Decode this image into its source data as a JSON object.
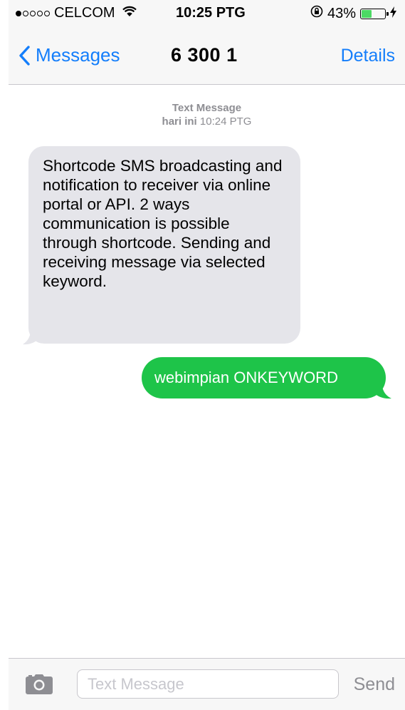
{
  "status_bar": {
    "signal_strength": 1,
    "signal_max": 5,
    "carrier": "CELCOM",
    "wifi_icon": "wifi-icon",
    "time": "10:25 PTG",
    "orientation_lock_icon": "orientation-lock-icon",
    "battery_percent": "43%",
    "battery_level": 0.43,
    "charging_icon": "lightning-bolt-icon",
    "battery_color": "#4cd964"
  },
  "nav": {
    "back_label": "Messages",
    "back_icon": "chevron-left-icon",
    "title": "6 300 1",
    "details_label": "Details",
    "accent_color": "#147efb"
  },
  "conversation": {
    "timestamp_head": "Text Message",
    "timestamp_day": "hari ini",
    "timestamp_time": "10:24 PTG",
    "messages": [
      {
        "direction": "incoming",
        "text": "Shortcode SMS broadcasting and notification to receiver via online portal or API. 2 ways communication is possible through shortcode. Sending and receiving message via selected keyword.",
        "bubble_color": "#e5e5ea"
      },
      {
        "direction": "outgoing",
        "text": "webimpian ONKEYWORD",
        "bubble_color": "#1ec449"
      }
    ]
  },
  "composer": {
    "camera_icon": "camera-icon",
    "placeholder": "Text Message",
    "value": "",
    "send_label": "Send"
  }
}
